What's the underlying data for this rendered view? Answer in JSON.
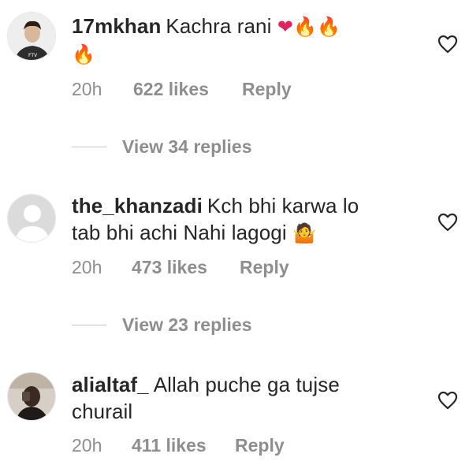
{
  "comments": [
    {
      "username": "17mkhan",
      "text": "Kachra rani",
      "emojis_line1": [
        "❤",
        "🔥",
        "🔥"
      ],
      "emojis_line2": [
        "🔥"
      ],
      "time": "20h",
      "likes": "622 likes",
      "reply": "Reply",
      "replies_label": "View 34 replies",
      "avatar_icon": "user-photo-avatar"
    },
    {
      "username": "the_khanzadi",
      "text_line1": "Kch bhi karwa lo",
      "text_line2": "tab bhi achi Nahi lagogi",
      "emoji": "🤷",
      "time": "20h",
      "likes": "473 likes",
      "reply": "Reply",
      "replies_label": "View 23 replies",
      "avatar_icon": "default-avatar"
    },
    {
      "username": "alialtaf_",
      "text_line1": "Allah puche ga tujse",
      "text_line2": "churail",
      "time": "20h",
      "likes": "411 likes",
      "reply": "Reply",
      "avatar_icon": "user-photo-avatar"
    }
  ],
  "colors": {
    "text": "#262626",
    "meta": "#8e8e8e",
    "heart": "#e0245e",
    "fire": "#f26b1d",
    "icon": "#262626"
  }
}
